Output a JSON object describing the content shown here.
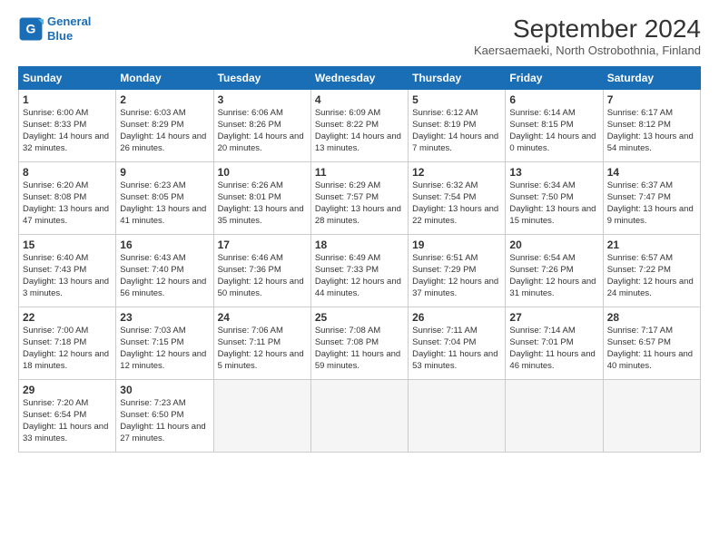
{
  "logo": {
    "line1": "General",
    "line2": "Blue"
  },
  "title": "September 2024",
  "subtitle": "Kaersaemaeki, North Ostrobothnia, Finland",
  "headers": [
    "Sunday",
    "Monday",
    "Tuesday",
    "Wednesday",
    "Thursday",
    "Friday",
    "Saturday"
  ],
  "weeks": [
    [
      {
        "day": "1",
        "sunrise": "Sunrise: 6:00 AM",
        "sunset": "Sunset: 8:33 PM",
        "daylight": "Daylight: 14 hours and 32 minutes."
      },
      {
        "day": "2",
        "sunrise": "Sunrise: 6:03 AM",
        "sunset": "Sunset: 8:29 PM",
        "daylight": "Daylight: 14 hours and 26 minutes."
      },
      {
        "day": "3",
        "sunrise": "Sunrise: 6:06 AM",
        "sunset": "Sunset: 8:26 PM",
        "daylight": "Daylight: 14 hours and 20 minutes."
      },
      {
        "day": "4",
        "sunrise": "Sunrise: 6:09 AM",
        "sunset": "Sunset: 8:22 PM",
        "daylight": "Daylight: 14 hours and 13 minutes."
      },
      {
        "day": "5",
        "sunrise": "Sunrise: 6:12 AM",
        "sunset": "Sunset: 8:19 PM",
        "daylight": "Daylight: 14 hours and 7 minutes."
      },
      {
        "day": "6",
        "sunrise": "Sunrise: 6:14 AM",
        "sunset": "Sunset: 8:15 PM",
        "daylight": "Daylight: 14 hours and 0 minutes."
      },
      {
        "day": "7",
        "sunrise": "Sunrise: 6:17 AM",
        "sunset": "Sunset: 8:12 PM",
        "daylight": "Daylight: 13 hours and 54 minutes."
      }
    ],
    [
      {
        "day": "8",
        "sunrise": "Sunrise: 6:20 AM",
        "sunset": "Sunset: 8:08 PM",
        "daylight": "Daylight: 13 hours and 47 minutes."
      },
      {
        "day": "9",
        "sunrise": "Sunrise: 6:23 AM",
        "sunset": "Sunset: 8:05 PM",
        "daylight": "Daylight: 13 hours and 41 minutes."
      },
      {
        "day": "10",
        "sunrise": "Sunrise: 6:26 AM",
        "sunset": "Sunset: 8:01 PM",
        "daylight": "Daylight: 13 hours and 35 minutes."
      },
      {
        "day": "11",
        "sunrise": "Sunrise: 6:29 AM",
        "sunset": "Sunset: 7:57 PM",
        "daylight": "Daylight: 13 hours and 28 minutes."
      },
      {
        "day": "12",
        "sunrise": "Sunrise: 6:32 AM",
        "sunset": "Sunset: 7:54 PM",
        "daylight": "Daylight: 13 hours and 22 minutes."
      },
      {
        "day": "13",
        "sunrise": "Sunrise: 6:34 AM",
        "sunset": "Sunset: 7:50 PM",
        "daylight": "Daylight: 13 hours and 15 minutes."
      },
      {
        "day": "14",
        "sunrise": "Sunrise: 6:37 AM",
        "sunset": "Sunset: 7:47 PM",
        "daylight": "Daylight: 13 hours and 9 minutes."
      }
    ],
    [
      {
        "day": "15",
        "sunrise": "Sunrise: 6:40 AM",
        "sunset": "Sunset: 7:43 PM",
        "daylight": "Daylight: 13 hours and 3 minutes."
      },
      {
        "day": "16",
        "sunrise": "Sunrise: 6:43 AM",
        "sunset": "Sunset: 7:40 PM",
        "daylight": "Daylight: 12 hours and 56 minutes."
      },
      {
        "day": "17",
        "sunrise": "Sunrise: 6:46 AM",
        "sunset": "Sunset: 7:36 PM",
        "daylight": "Daylight: 12 hours and 50 minutes."
      },
      {
        "day": "18",
        "sunrise": "Sunrise: 6:49 AM",
        "sunset": "Sunset: 7:33 PM",
        "daylight": "Daylight: 12 hours and 44 minutes."
      },
      {
        "day": "19",
        "sunrise": "Sunrise: 6:51 AM",
        "sunset": "Sunset: 7:29 PM",
        "daylight": "Daylight: 12 hours and 37 minutes."
      },
      {
        "day": "20",
        "sunrise": "Sunrise: 6:54 AM",
        "sunset": "Sunset: 7:26 PM",
        "daylight": "Daylight: 12 hours and 31 minutes."
      },
      {
        "day": "21",
        "sunrise": "Sunrise: 6:57 AM",
        "sunset": "Sunset: 7:22 PM",
        "daylight": "Daylight: 12 hours and 24 minutes."
      }
    ],
    [
      {
        "day": "22",
        "sunrise": "Sunrise: 7:00 AM",
        "sunset": "Sunset: 7:18 PM",
        "daylight": "Daylight: 12 hours and 18 minutes."
      },
      {
        "day": "23",
        "sunrise": "Sunrise: 7:03 AM",
        "sunset": "Sunset: 7:15 PM",
        "daylight": "Daylight: 12 hours and 12 minutes."
      },
      {
        "day": "24",
        "sunrise": "Sunrise: 7:06 AM",
        "sunset": "Sunset: 7:11 PM",
        "daylight": "Daylight: 12 hours and 5 minutes."
      },
      {
        "day": "25",
        "sunrise": "Sunrise: 7:08 AM",
        "sunset": "Sunset: 7:08 PM",
        "daylight": "Daylight: 11 hours and 59 minutes."
      },
      {
        "day": "26",
        "sunrise": "Sunrise: 7:11 AM",
        "sunset": "Sunset: 7:04 PM",
        "daylight": "Daylight: 11 hours and 53 minutes."
      },
      {
        "day": "27",
        "sunrise": "Sunrise: 7:14 AM",
        "sunset": "Sunset: 7:01 PM",
        "daylight": "Daylight: 11 hours and 46 minutes."
      },
      {
        "day": "28",
        "sunrise": "Sunrise: 7:17 AM",
        "sunset": "Sunset: 6:57 PM",
        "daylight": "Daylight: 11 hours and 40 minutes."
      }
    ],
    [
      {
        "day": "29",
        "sunrise": "Sunrise: 7:20 AM",
        "sunset": "Sunset: 6:54 PM",
        "daylight": "Daylight: 11 hours and 33 minutes."
      },
      {
        "day": "30",
        "sunrise": "Sunrise: 7:23 AM",
        "sunset": "Sunset: 6:50 PM",
        "daylight": "Daylight: 11 hours and 27 minutes."
      },
      null,
      null,
      null,
      null,
      null
    ]
  ]
}
